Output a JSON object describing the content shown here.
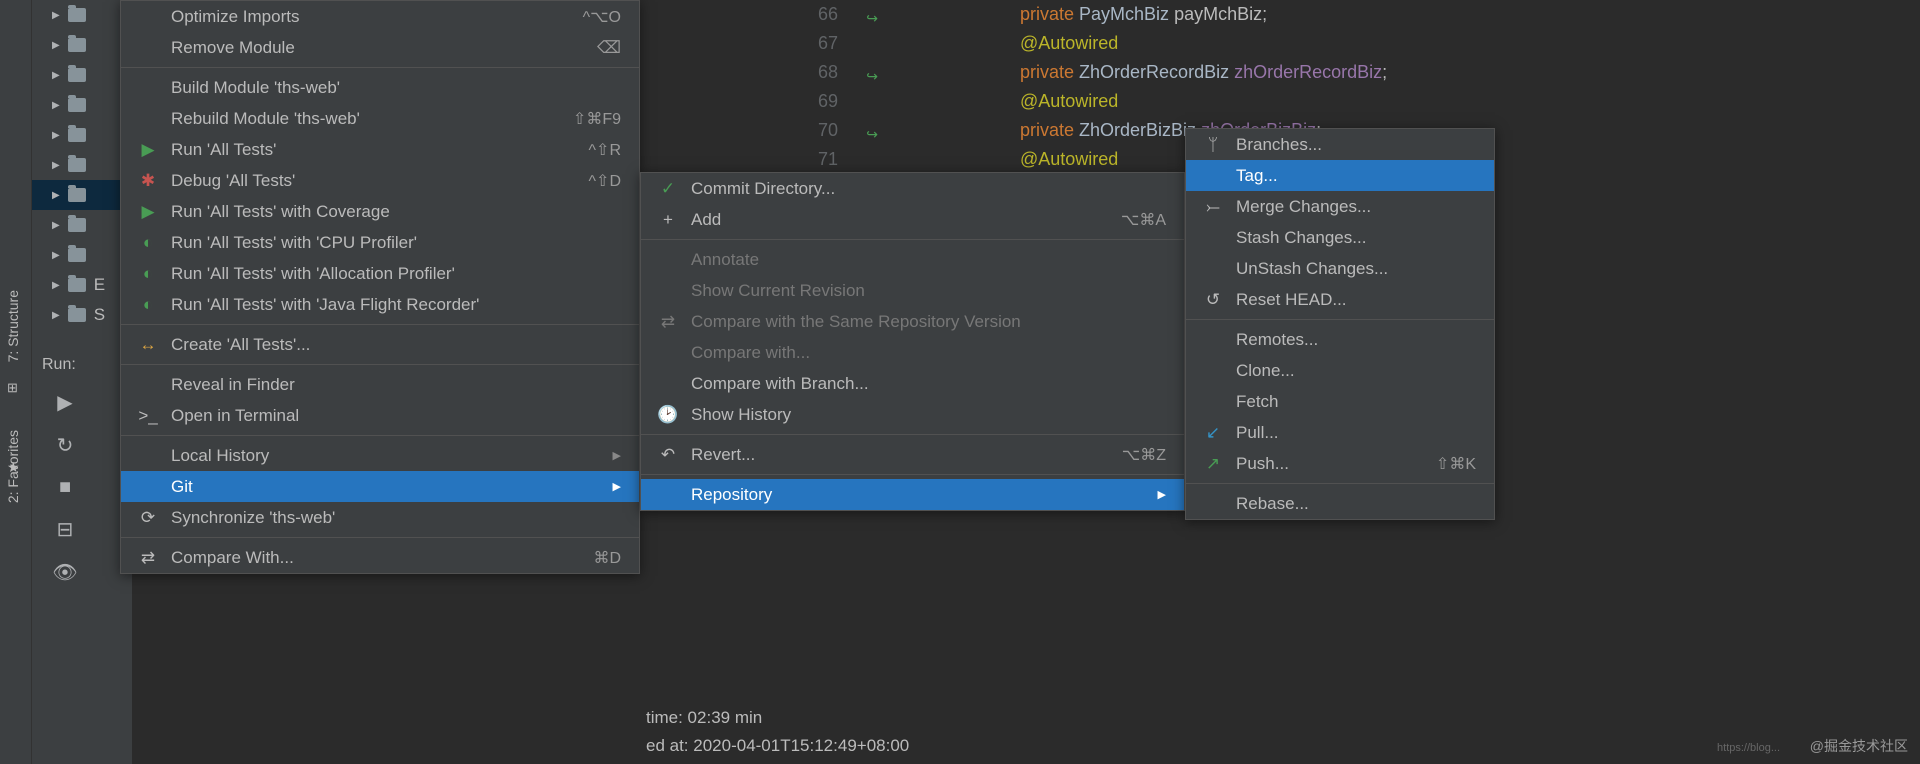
{
  "toolStripLabels": {
    "structure": "7: Structure",
    "favorites": "2: Favorites"
  },
  "treeRows": [
    {
      "sel": false
    },
    {
      "sel": false
    },
    {
      "sel": false
    },
    {
      "sel": false
    },
    {
      "sel": false
    },
    {
      "sel": false
    },
    {
      "sel": true
    },
    {
      "sel": false
    },
    {
      "sel": false
    },
    {
      "sel": false
    },
    {
      "sel": false
    }
  ],
  "runLabel": "Run:",
  "menu1": [
    {
      "type": "item",
      "icon": "",
      "label": "Optimize Imports",
      "shortcut": "^⌥O"
    },
    {
      "type": "item",
      "icon": "⌫",
      "label": "Remove Module",
      "shortcut": "",
      "iconRight": true
    },
    {
      "type": "sep"
    },
    {
      "type": "item",
      "icon": "",
      "label": "Build Module 'ths-web'",
      "shortcut": ""
    },
    {
      "type": "item",
      "icon": "",
      "label": "Rebuild Module 'ths-web'",
      "shortcut": "⇧⌘F9"
    },
    {
      "type": "item",
      "icon": "▶",
      "iconClass": "green-tri",
      "label": "Run 'All Tests'",
      "shortcut": "^⇧R"
    },
    {
      "type": "item",
      "icon": "✱",
      "iconClass": "red-bug",
      "label": "Debug 'All Tests'",
      "shortcut": "^⇧D"
    },
    {
      "type": "item",
      "icon": "▶",
      "iconClass": "green-tri",
      "label": "Run 'All Tests' with Coverage",
      "shortcut": ""
    },
    {
      "type": "item",
      "icon": "◐",
      "iconClass": "green-tri",
      "label": "Run 'All Tests' with 'CPU Profiler'",
      "shortcut": ""
    },
    {
      "type": "item",
      "icon": "◐",
      "iconClass": "green-tri",
      "label": "Run 'All Tests' with 'Allocation Profiler'",
      "shortcut": ""
    },
    {
      "type": "item",
      "icon": "◐",
      "iconClass": "green-tri",
      "label": "Run 'All Tests' with 'Java Flight Recorder'",
      "shortcut": ""
    },
    {
      "type": "sep"
    },
    {
      "type": "item",
      "icon": "↔",
      "iconClass": "yellow-light",
      "label": "Create 'All Tests'...",
      "shortcut": ""
    },
    {
      "type": "sep"
    },
    {
      "type": "item",
      "icon": "",
      "label": "Reveal in Finder",
      "shortcut": ""
    },
    {
      "type": "item",
      "icon": ">_",
      "label": "Open in Terminal",
      "shortcut": ""
    },
    {
      "type": "sep"
    },
    {
      "type": "item",
      "icon": "",
      "label": "Local History",
      "shortcut": "",
      "submenu": true
    },
    {
      "type": "item",
      "icon": "",
      "label": "Git",
      "shortcut": "",
      "submenu": true,
      "selected": true
    },
    {
      "type": "item",
      "icon": "⟳",
      "label": "Synchronize 'ths-web'",
      "shortcut": ""
    },
    {
      "type": "sep"
    },
    {
      "type": "item",
      "icon": "⇄",
      "label": "Compare With...",
      "shortcut": "⌘D"
    }
  ],
  "menu2": [
    {
      "type": "item",
      "icon": "✓",
      "iconClass": "green-tri",
      "label": "Commit Directory...",
      "shortcut": ""
    },
    {
      "type": "item",
      "icon": "+",
      "label": "Add",
      "shortcut": "⌥⌘A"
    },
    {
      "type": "sep"
    },
    {
      "type": "item",
      "icon": "",
      "label": "Annotate",
      "disabled": true
    },
    {
      "type": "item",
      "icon": "",
      "label": "Show Current Revision",
      "disabled": true
    },
    {
      "type": "item",
      "icon": "⇄",
      "label": "Compare with the Same Repository Version",
      "disabled": true
    },
    {
      "type": "item",
      "icon": "",
      "label": "Compare with...",
      "disabled": true
    },
    {
      "type": "item",
      "icon": "",
      "label": "Compare with Branch..."
    },
    {
      "type": "item",
      "icon": "🕑",
      "label": "Show History"
    },
    {
      "type": "sep"
    },
    {
      "type": "item",
      "icon": "↶",
      "label": "Revert...",
      "shortcut": "⌥⌘Z"
    },
    {
      "type": "sep"
    },
    {
      "type": "item",
      "icon": "",
      "label": "Repository",
      "submenu": true,
      "selected": true
    }
  ],
  "menu3": [
    {
      "type": "item",
      "icon": "ᛘ",
      "label": "Branches..."
    },
    {
      "type": "item",
      "icon": "",
      "label": "Tag...",
      "selected": true
    },
    {
      "type": "item",
      "icon": "⤚",
      "label": "Merge Changes..."
    },
    {
      "type": "item",
      "icon": "",
      "label": "Stash Changes..."
    },
    {
      "type": "item",
      "icon": "",
      "label": "UnStash Changes..."
    },
    {
      "type": "item",
      "icon": "↺",
      "label": "Reset HEAD..."
    },
    {
      "type": "sep"
    },
    {
      "type": "item",
      "icon": "",
      "label": "Remotes..."
    },
    {
      "type": "item",
      "icon": "",
      "label": "Clone..."
    },
    {
      "type": "item",
      "icon": "",
      "label": "Fetch"
    },
    {
      "type": "item",
      "icon": "↙",
      "iconClass": "",
      "iconColor": "#3592c4",
      "label": "Pull..."
    },
    {
      "type": "item",
      "icon": "↗",
      "iconColor": "#499c54",
      "label": "Push...",
      "shortcut": "⇧⌘K"
    },
    {
      "type": "sep"
    },
    {
      "type": "item",
      "icon": "",
      "label": "Rebase..."
    }
  ],
  "editorLines": [
    {
      "num": "66",
      "gutter": true,
      "tokens": [
        [
          "private ",
          "kw-private"
        ],
        [
          "PayMchBiz ",
          "kw-type"
        ],
        [
          "payMchBiz",
          ""
        ],
        [
          ";",
          ""
        ]
      ]
    },
    {
      "num": "67",
      "gutter": false,
      "tokens": [
        [
          "@Autowired",
          "kw-anno"
        ]
      ]
    },
    {
      "num": "68",
      "gutter": true,
      "tokens": [
        [
          "private ",
          "kw-private"
        ],
        [
          "ZhOrderRecordBiz ",
          "kw-type"
        ],
        [
          "zhOrderRecordBiz",
          "kw-field"
        ],
        [
          ";",
          ""
        ]
      ]
    },
    {
      "num": "69",
      "gutter": false,
      "tokens": [
        [
          "@Autowired",
          "kw-anno"
        ]
      ]
    },
    {
      "num": "70",
      "gutter": true,
      "tokens": [
        [
          "private ",
          "kw-private"
        ],
        [
          "ZhOrderBizBiz ",
          "kw-type"
        ],
        [
          "zhOrderBizBiz",
          "kw-field"
        ],
        [
          ";",
          ""
        ]
      ]
    },
    {
      "num": "71",
      "gutter": false,
      "tokens": [
        [
          "@Autowired",
          "kw-anno"
        ]
      ]
    }
  ],
  "console": [
    "time:  02:39 min",
    "ed at: 2020-04-01T15:12:49+08:00"
  ],
  "watermark": "@掘金技术社区",
  "watermarkSmall": "https://blog..."
}
